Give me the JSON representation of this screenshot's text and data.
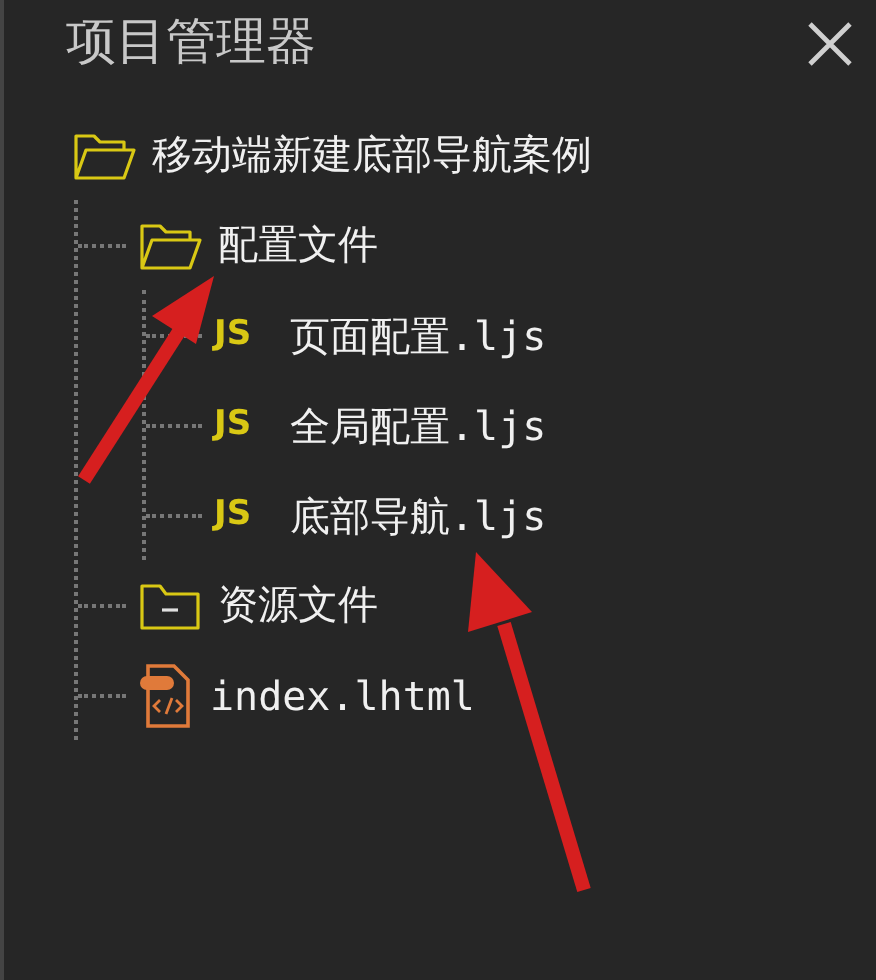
{
  "panel": {
    "title": "项目管理器"
  },
  "tree": [
    {
      "kind": "folder",
      "label": "移动端新建底部导航案例",
      "expanded": true,
      "children": [
        {
          "kind": "folder",
          "label": "配置文件",
          "expanded": true,
          "children": [
            {
              "kind": "js",
              "badge": "JS",
              "label": "页面配置.ljs"
            },
            {
              "kind": "js",
              "badge": "JS",
              "label": "全局配置.ljs"
            },
            {
              "kind": "js",
              "badge": "JS",
              "label": "底部导航.ljs"
            }
          ]
        },
        {
          "kind": "folder",
          "label": "资源文件",
          "expanded": false
        },
        {
          "kind": "html",
          "label": "index.lhtml"
        }
      ]
    }
  ]
}
